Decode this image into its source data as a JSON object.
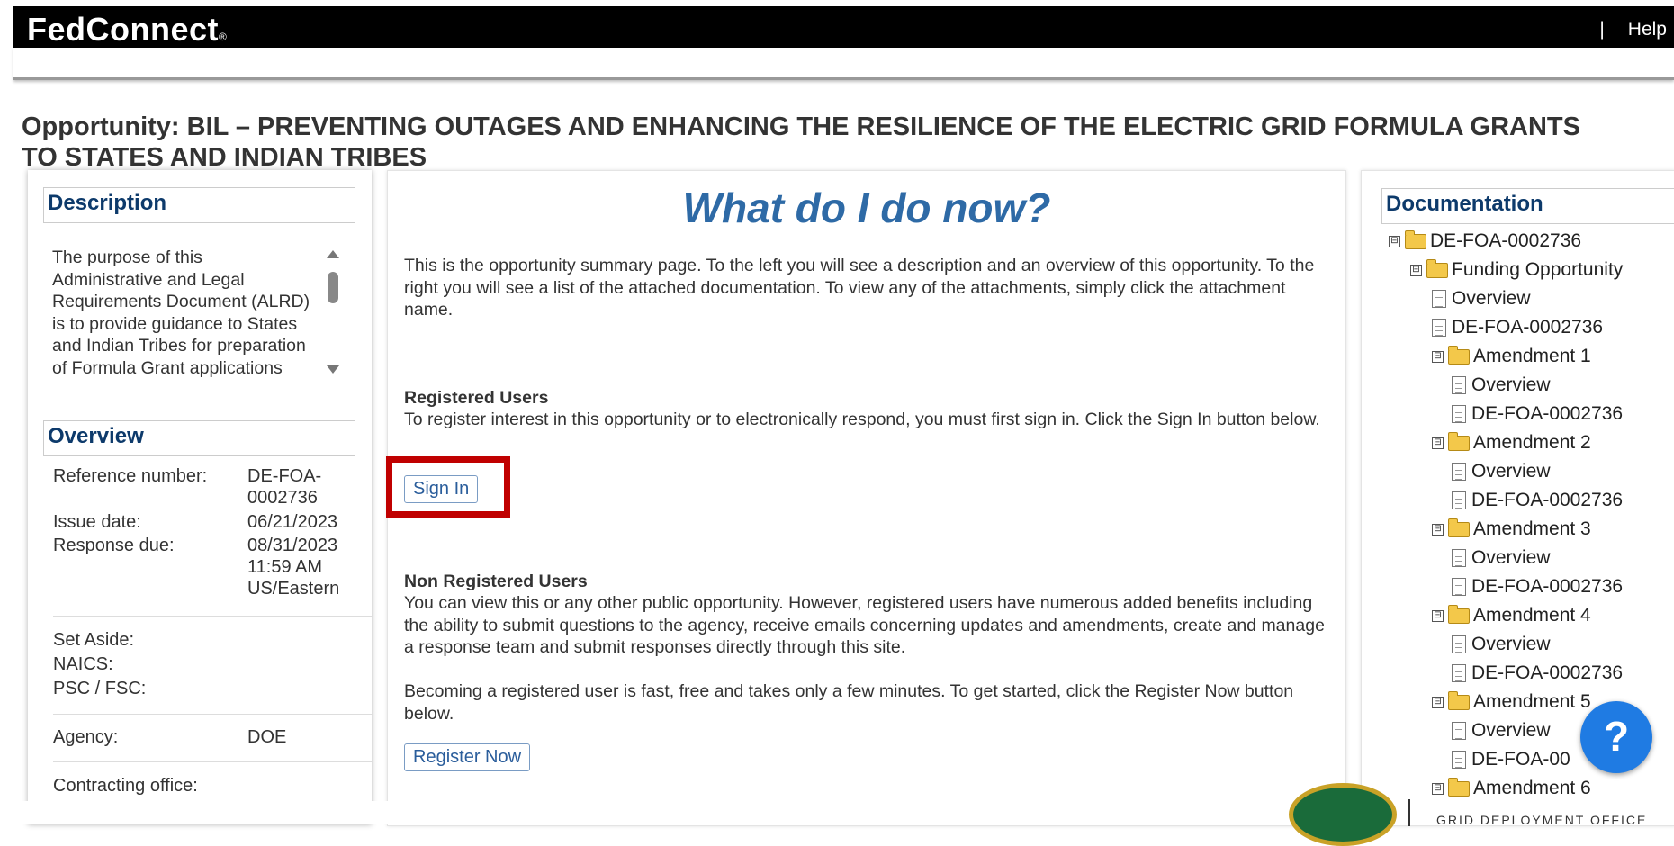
{
  "header": {
    "brand": "FedConnect",
    "brand_mark": "®",
    "separator": "|",
    "help_label": "Help"
  },
  "opportunity": {
    "title_line1": "Opportunity: BIL – PREVENTING OUTAGES AND ENHANCING THE RESILIENCE OF THE ELECTRIC GRID FORMULA GRANTS",
    "title_line2": "TO STATES AND INDIAN TRIBES"
  },
  "description": {
    "heading": "Description",
    "text": "The purpose of this Administrative and Legal Requirements Document (ALRD) is to provide guidance to States and Indian Tribes for preparation of Formula Grant applications submitted in response to this ALRD."
  },
  "overview": {
    "heading": "Overview",
    "reference_label": "Reference number:",
    "reference_value_1": "DE-FOA-",
    "reference_value_2": "0002736",
    "issue_label": "Issue date:",
    "issue_value": "06/21/2023",
    "response_label": "Response due:",
    "response_value_1": "08/31/2023",
    "response_value_2": "11:59 AM",
    "response_value_3": "US/Eastern",
    "set_aside_label": "Set Aside:",
    "naics_label": "NAICS:",
    "psc_label": "PSC / FSC:",
    "agency_label": "Agency:",
    "agency_value": "DOE",
    "contracting_label": "Contracting office:"
  },
  "center": {
    "heading": "What do I do now?",
    "intro": "This is the opportunity summary page. To the left you will see a description and an overview of this opportunity. To the right you will see a list of the attached documentation. To view any of the attachments, simply click the attachment name.",
    "registered_heading": "Registered Users",
    "registered_text": "To register interest in this opportunity or to electronically respond, you must first sign in. Click the Sign In button below.",
    "sign_in_label": "Sign In",
    "non_registered_heading": "Non Registered Users",
    "non_registered_text": "You can view this or any other public opportunity. However, registered users have numerous added benefits including the ability to submit questions to the agency, receive emails concerning updates and amendments, create and manage a response team and submit responses directly through this site.",
    "register_text": "Becoming a registered user is fast, free and takes only a few minutes. To get started, click the Register Now button below.",
    "register_label": "Register Now"
  },
  "documentation": {
    "heading": "Documentation",
    "toggle": "⊟",
    "root": "DE-FOA-0002736",
    "funding": "Funding Opportunity",
    "overview": "Overview",
    "doc": "DE-FOA-0002736",
    "doc_truncated": "DE-FOA-00",
    "amendments": [
      "Amendment 1",
      "Amendment 2",
      "Amendment 3",
      "Amendment 4",
      "Amendment 5",
      "Amendment 6"
    ]
  },
  "help_fab": "?",
  "footer": {
    "office": "GRID DEPLOYMENT OFFICE"
  },
  "colors": {
    "accent": "#2e6aa6",
    "highlight": "#c00000",
    "fab": "#1f7be3"
  }
}
